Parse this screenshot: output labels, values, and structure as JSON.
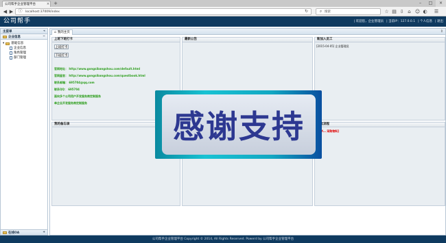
{
  "browser": {
    "tab_title": "公司帮手企业管理平台",
    "url": "localhost:37009/index",
    "search_placeholder": "搜索"
  },
  "app": {
    "logo_text": "公司帮手",
    "top_links": [
      "| 欢迎您，企业管理员",
      "| 当前IP：127.0.0.1",
      "| 个人信息",
      "| 退出"
    ]
  },
  "sidebar": {
    "title": "主菜单",
    "section": "企业信息",
    "tree": [
      {
        "label": "基础信息",
        "level": 1,
        "icon": "folder-icon"
      },
      {
        "label": "企业信息",
        "level": 2,
        "icon": "doc-icon"
      },
      {
        "label": "角色管理",
        "level": 2,
        "icon": "doc-icon"
      },
      {
        "label": "部门管理",
        "level": 2,
        "icon": "doc-icon"
      }
    ],
    "footer": "在线OA"
  },
  "main": {
    "tab_label": "我的主页",
    "portlets": {
      "attendance": {
        "title": "上班下班打卡",
        "clock_in": "上班打卡",
        "clock_out": "下班打卡",
        "lines": [
          "官网地址： http://www.gongsibangshou.com/default.html",
          "官网留言： http://www.gongsibangshou.com/questbook.html",
          "联系邮箱： 695704@qq.com",
          "联系QQ： 695704",
          "面向多个公司用户开发服务商定制服务",
          "单企业开发服务商定制服务"
        ]
      },
      "notice": {
        "title": "最新公告"
      },
      "new_staff": {
        "title": "新加入员工",
        "entry": "[2015-04-05] 企业管理员"
      },
      "memo": {
        "title": "我的备忘录"
      },
      "approval": {
        "title": "审批流程",
        "entry": "[实学… 采购物料]"
      }
    }
  },
  "overlay": {
    "text": "感谢支持"
  },
  "footer": {
    "text": "公司帮手企业管理平台 Copyright © 2014, All Rights Reserved. Powerd by 公司帮手企业管理平台"
  },
  "colors": {
    "header": "#0f3a5f",
    "link_green": "#2b9d1a",
    "alert_red": "#e00000"
  }
}
